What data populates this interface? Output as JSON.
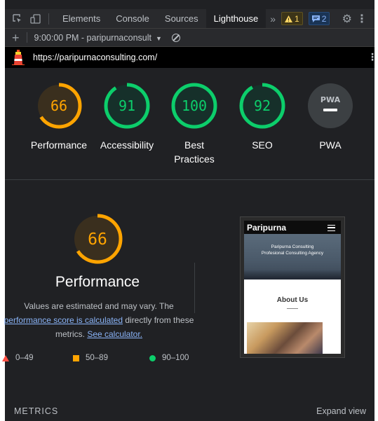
{
  "devtools": {
    "tabs": [
      {
        "label": "Elements"
      },
      {
        "label": "Console"
      },
      {
        "label": "Sources"
      },
      {
        "label": "Lighthouse"
      }
    ],
    "more": "»",
    "warnings_count": "1",
    "messages_count": "2"
  },
  "report": {
    "selector_label": "9:00:00 PM - paripurnaconsult",
    "url": "https://paripurnaconsulting.com/"
  },
  "gauges": [
    {
      "label": "Performance",
      "score": "66",
      "color": "#ffa400",
      "fraction": 0.66
    },
    {
      "label": "Accessibility",
      "score": "91",
      "color": "#0cce6b",
      "fraction": 0.91
    },
    {
      "label": "Best Practices",
      "score": "100",
      "color": "#0cce6b",
      "fraction": 1.0
    },
    {
      "label": "SEO",
      "score": "92",
      "color": "#0cce6b",
      "fraction": 0.92
    },
    {
      "label": "PWA",
      "badge": "PWA"
    }
  ],
  "performance": {
    "score": "66",
    "fraction": 0.66,
    "title": "Performance",
    "desc_part1": "Values are estimated and may vary. The",
    "desc_link1": "performance score is calculated",
    "desc_part2": " directly from these metrics. ",
    "desc_link2": "See calculator."
  },
  "legend": [
    {
      "label": "0–49",
      "color": "#ff4e42"
    },
    {
      "label": "50–89",
      "color": "#ffa400"
    },
    {
      "label": "90–100",
      "color": "#0cce6b"
    }
  ],
  "screenshot": {
    "brand": "Paripurna",
    "hero_line1": "Paripurna Consulting",
    "hero_line2": "Profesional Consulting Agency",
    "section": "About Us"
  },
  "footer": {
    "metrics_label": "METRICS",
    "expand_label": "Expand view"
  }
}
